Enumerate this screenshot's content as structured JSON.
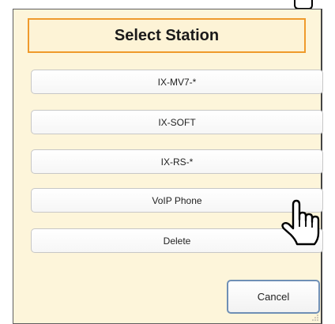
{
  "dialog": {
    "title": "Select Station",
    "buttons": [
      {
        "label": "IX-MV7-*"
      },
      {
        "label": "IX-SOFT"
      },
      {
        "label": "IX-RS-*"
      },
      {
        "label": "VoIP Phone"
      },
      {
        "label": "Delete"
      }
    ],
    "cancel_label": "Cancel"
  },
  "icons": {
    "pointer_hand": "hand-pointer-icon",
    "resize": "resize-grip-icon"
  },
  "colors": {
    "dialog_bg": "#fdf5da",
    "title_border": "#ef9a2c",
    "cancel_border": "#6f8fb5"
  }
}
